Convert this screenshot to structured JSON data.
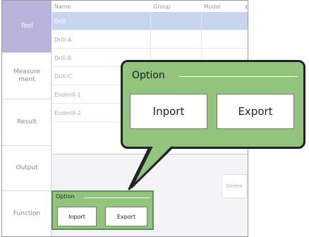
{
  "sidebar": {
    "items": [
      {
        "label": "Tool",
        "active": true
      },
      {
        "label": "Measure ment",
        "active": false
      },
      {
        "label": "Result",
        "active": false
      },
      {
        "label": "Output",
        "active": false
      },
      {
        "label": "Function",
        "active": false
      }
    ]
  },
  "table": {
    "headers": [
      "Name",
      "Group",
      "Model"
    ],
    "rows": [
      {
        "name": "Drill",
        "group": "",
        "model": "",
        "selected": true
      },
      {
        "name": "Drill-A",
        "group": "",
        "model": "",
        "selected": false
      },
      {
        "name": "Drill-B",
        "group": "",
        "model": "",
        "selected": false
      },
      {
        "name": "Drill-C",
        "group": "",
        "model": "",
        "selected": false
      },
      {
        "name": "Endmill-1",
        "group": "",
        "model": "",
        "selected": false
      },
      {
        "name": "Endmill-2",
        "group": "",
        "model": "",
        "selected": false
      }
    ]
  },
  "delete_label": "Delete",
  "option_panel": {
    "title": "Option",
    "import_label": "Inport",
    "export_label": "Export"
  },
  "callout": {
    "title": "Option",
    "import_label": "Inport",
    "export_label": "Export"
  },
  "colors": {
    "accent_purple": "#b9b2da",
    "selected_row": "#c9d5ef",
    "option_green": "#92c47e"
  }
}
